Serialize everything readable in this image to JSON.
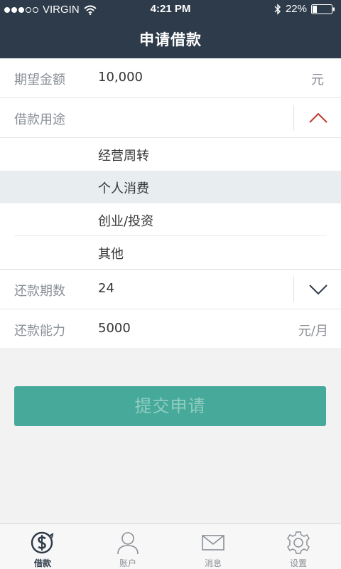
{
  "status_bar": {
    "carrier": "VIRGIN",
    "time": "4:21 PM",
    "battery": "22%"
  },
  "header": {
    "title": "申请借款"
  },
  "form": {
    "amount": {
      "label": "期望金额",
      "value": "10,000",
      "unit": "元"
    },
    "purpose": {
      "label": "借款用途",
      "value": "",
      "options": [
        "经营周转",
        "个人消费",
        "创业/投资",
        "其他"
      ],
      "selected_index": 1
    },
    "term": {
      "label": "还款期数",
      "value": "24"
    },
    "ability": {
      "label": "还款能力",
      "value": "5000",
      "unit": "元/月"
    }
  },
  "submit_label": "提交申请",
  "tabbar": {
    "tabs": [
      {
        "label": "借款",
        "icon": "loan-icon",
        "active": true
      },
      {
        "label": "账户",
        "icon": "user-icon",
        "active": false
      },
      {
        "label": "消息",
        "icon": "mail-icon",
        "active": false
      },
      {
        "label": "设置",
        "icon": "gear-icon",
        "active": false
      }
    ]
  },
  "colors": {
    "header_bg": "#2e3b4a",
    "primary": "#47a999",
    "chevron_up": "#c0392b",
    "chevron_down": "#2e3b4a"
  }
}
